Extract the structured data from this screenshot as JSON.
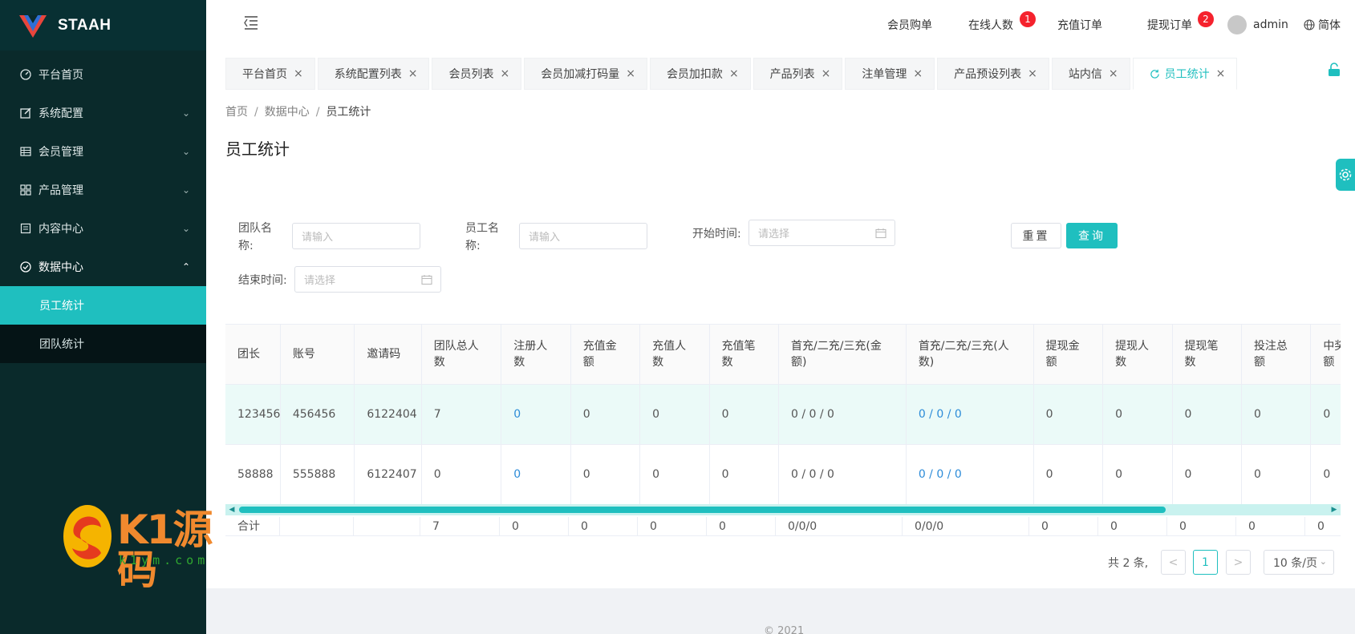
{
  "app": {
    "brand": "STAAH"
  },
  "sidebar": {
    "items": [
      {
        "label": "平台首页",
        "icon": "dashboard-icon"
      },
      {
        "label": "系统配置",
        "icon": "edit-icon",
        "has_children": true
      },
      {
        "label": "会员管理",
        "icon": "table-icon",
        "has_children": true
      },
      {
        "label": "产品管理",
        "icon": "grid-icon",
        "has_children": true
      },
      {
        "label": "内容中心",
        "icon": "document-icon",
        "has_children": true
      },
      {
        "label": "数据中心",
        "icon": "check-circle-icon",
        "has_children": true,
        "expanded": true
      }
    ],
    "subitems": [
      {
        "label": "员工统计",
        "selected": true
      },
      {
        "label": "团队统计",
        "selected": false
      }
    ]
  },
  "header": {
    "nav": [
      {
        "label": "会员购单"
      },
      {
        "label": "在线人数",
        "badge": "1"
      },
      {
        "label": "充值订单"
      },
      {
        "label": "提现订单",
        "badge": "2"
      }
    ],
    "user": "admin",
    "language": "简体"
  },
  "tabs": [
    {
      "label": "平台首页"
    },
    {
      "label": "系统配置列表"
    },
    {
      "label": "会员列表"
    },
    {
      "label": "会员加减打码量"
    },
    {
      "label": "会员加扣款"
    },
    {
      "label": "产品列表"
    },
    {
      "label": "注单管理"
    },
    {
      "label": "产品预设列表"
    },
    {
      "label": "站内信"
    },
    {
      "label": "员工统计",
      "active": true
    }
  ],
  "tab_close_glyph": "×",
  "breadcrumb": {
    "home": "首页",
    "section": "数据中心",
    "current": "员工统计",
    "separator": "/"
  },
  "page_title": "员工统计",
  "filters": {
    "team_name_label": "团队名称:",
    "team_name_placeholder": "请输入",
    "staff_name_label": "员工名称:",
    "staff_name_placeholder": "请输入",
    "start_time_label": "开始时间:",
    "start_time_placeholder": "请选择",
    "end_time_label": "结束时间:",
    "end_time_placeholder": "请选择",
    "reset_label": "重置",
    "query_label": "查询"
  },
  "table": {
    "columns": [
      "团长",
      "账号",
      "邀请码",
      "团队总人数",
      "注册人数",
      "充值金额",
      "充值人数",
      "充值笔数",
      "首充/二充/三充(金额)",
      "首充/二充/三充(人数)",
      "提现金额",
      "提现人数",
      "提现笔数",
      "投注总额",
      "中奖金额"
    ],
    "rows": [
      [
        "123456",
        "456456",
        "6122404",
        "7",
        "0",
        "0",
        "0",
        "0",
        "0 / 0 / 0",
        "0 / 0 / 0",
        "0",
        "0",
        "0",
        "0",
        "0"
      ],
      [
        "58888",
        "555888",
        "6122407",
        "0",
        "0",
        "0",
        "0",
        "0",
        "0 / 0 / 0",
        "0 / 0 / 0",
        "0",
        "0",
        "0",
        "0",
        "0"
      ]
    ],
    "summary": [
      "合计",
      "",
      "",
      "7",
      "0",
      "0",
      "0",
      "0",
      "0/0/0",
      "0/0/0",
      "0",
      "0",
      "0",
      "0",
      "0"
    ]
  },
  "pagination": {
    "total_text": "共 2 条,",
    "current_page": "1",
    "page_size": "10 条/页",
    "prev": "<",
    "next": ">"
  },
  "footer": {
    "copyright": "© 2021"
  },
  "watermark": {
    "main": "K1源码",
    "sub": "k1ym.com"
  },
  "colors": {
    "accent": "#1fbfbf",
    "sidebar": "#0a2a2b",
    "badge": "#f5222d",
    "link": "#2d8cd8"
  }
}
